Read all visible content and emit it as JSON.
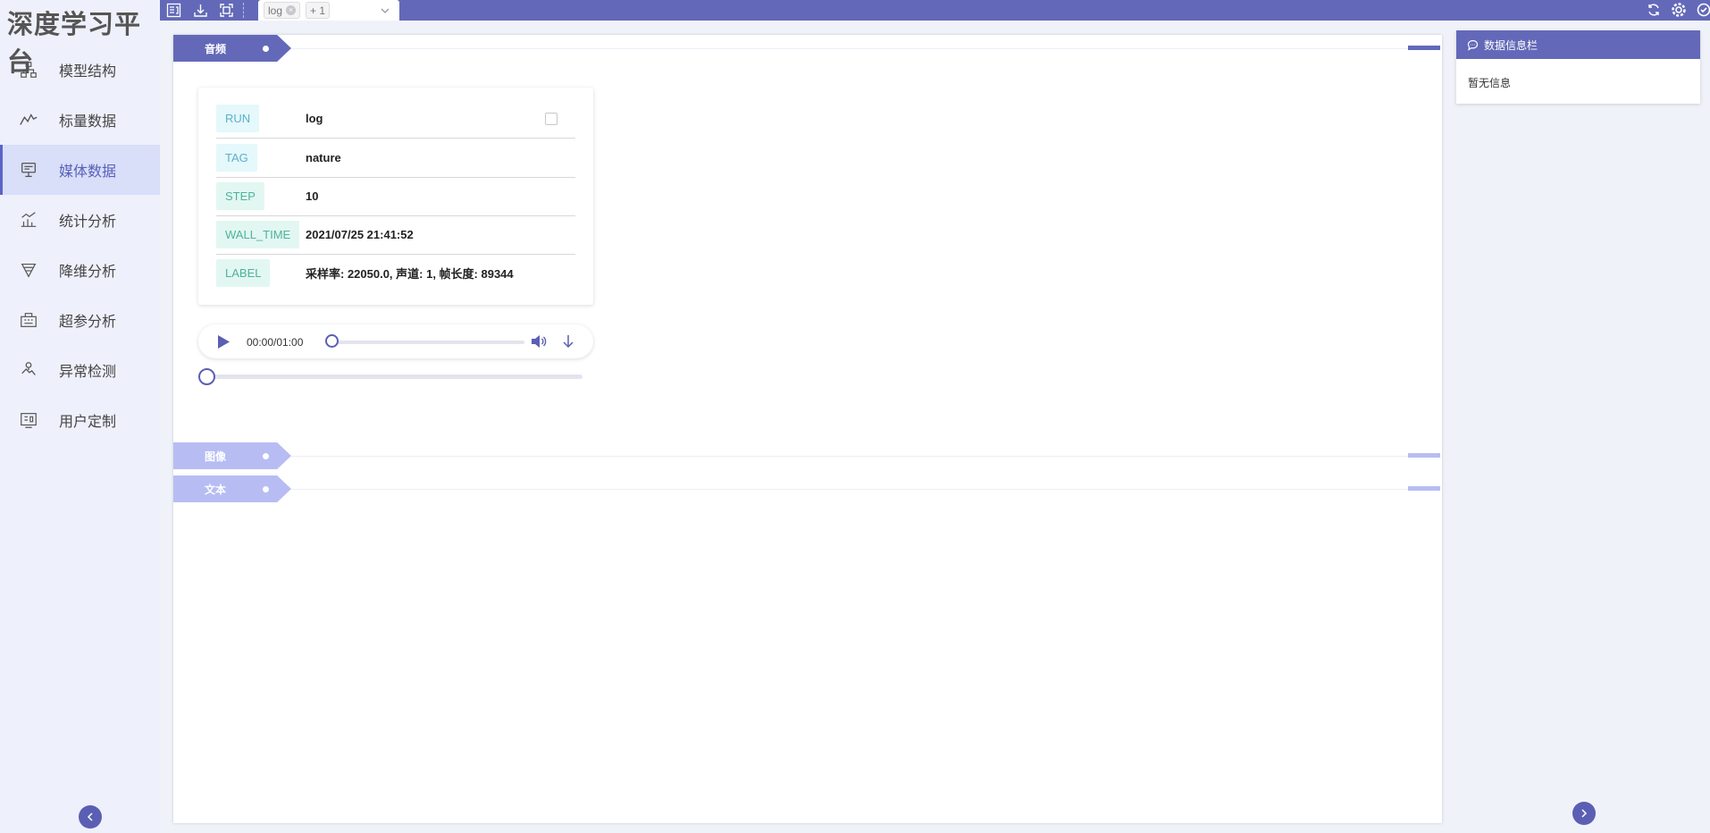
{
  "app": {
    "title": "深度学习平台"
  },
  "sidebar": {
    "items": [
      {
        "label": "模型结构",
        "icon": "model-structure-icon"
      },
      {
        "label": "标量数据",
        "icon": "scalar-chart-icon"
      },
      {
        "label": "媒体数据",
        "icon": "media-monitor-icon",
        "active": true
      },
      {
        "label": "统计分析",
        "icon": "statistics-icon"
      },
      {
        "label": "降维分析",
        "icon": "dimension-reduction-icon"
      },
      {
        "label": "超参分析",
        "icon": "hyperparam-icon"
      },
      {
        "label": "异常检测",
        "icon": "anomaly-icon"
      },
      {
        "label": "用户定制",
        "icon": "custom-icon"
      }
    ]
  },
  "toolbar": {
    "run_select": {
      "chip": "log",
      "more": "+ 1"
    }
  },
  "sections": {
    "audio": "音频",
    "image": "图像",
    "text": "文本"
  },
  "card": {
    "rows": [
      {
        "key": "RUN",
        "value": "log"
      },
      {
        "key": "TAG",
        "value": "nature"
      },
      {
        "key": "STEP",
        "value": "10"
      },
      {
        "key": "WALL_TIME",
        "value": "2021/07/25 21:41:52"
      },
      {
        "key": "LABEL",
        "value": "采样率: 22050.0, 声道: 1, 帧长度: 89344"
      }
    ]
  },
  "player": {
    "time": "00:00/01:00",
    "progress": 0,
    "step_slider": 0
  },
  "info_panel": {
    "title": "数据信息栏",
    "body": "暂无信息"
  },
  "colors": {
    "accent": "#6369b8",
    "active_bg": "#d9def9",
    "tag_light": "#b7bdf3"
  }
}
